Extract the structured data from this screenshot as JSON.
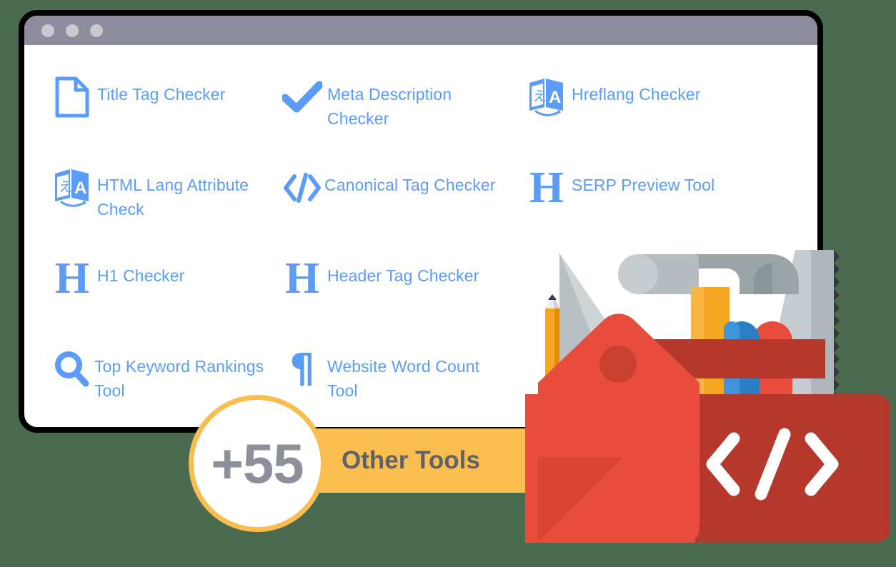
{
  "colors": {
    "page_background": "#4a6b50",
    "window_border": "#000000",
    "titlebar": "#8d8d9d",
    "titlebar_dot": "#c9c9cf",
    "link_blue": "#5a9cf8",
    "badge_orange": "#fabd4f",
    "badge_text_gray": "#5f6368",
    "badge_number_gray": "#8d909a",
    "toolbox_red": "#e74c3c",
    "toolbox_dark_red": "#b5382c",
    "tool_gray": "#b0b7bb",
    "tool_orange": "#f5a623",
    "tool_blue": "#2b7fc4"
  },
  "window": {
    "titlebar": {
      "dots": [
        "window-dot-1",
        "window-dot-2",
        "window-dot-3"
      ]
    }
  },
  "tools": {
    "rows": [
      [
        {
          "icon": "document-icon",
          "label": "Title Tag Checker"
        },
        {
          "icon": "checkmark-icon",
          "label": "Meta Description Checker"
        },
        {
          "icon": "translate-icon",
          "label": "Hreflang Checker"
        }
      ],
      [
        {
          "icon": "translate-icon",
          "label": "HTML Lang Attribute Check"
        },
        {
          "icon": "code-icon",
          "label": "Canonical Tag Checker"
        },
        {
          "icon": "heading-h-icon",
          "label": "SERP Preview Tool"
        }
      ],
      [
        {
          "icon": "heading-h-icon",
          "label": "H1 Checker"
        },
        {
          "icon": "heading-h-icon",
          "label": "Header Tag Checker"
        },
        {
          "icon": "",
          "label": ""
        }
      ],
      [
        {
          "icon": "search-icon",
          "label": "Top Keyword Rankings Tool"
        },
        {
          "icon": "pilcrow-icon",
          "label": "Website Word Count Tool"
        },
        {
          "icon": "",
          "label": ""
        }
      ]
    ]
  },
  "badge": {
    "count": "+55",
    "label": "Other Tools"
  },
  "illustration": {
    "name": "toolbox-with-tools",
    "code_glyph": "</>",
    "items": [
      "pencil",
      "ruler",
      "hammer",
      "saw",
      "screwdriver",
      "wrench"
    ]
  }
}
